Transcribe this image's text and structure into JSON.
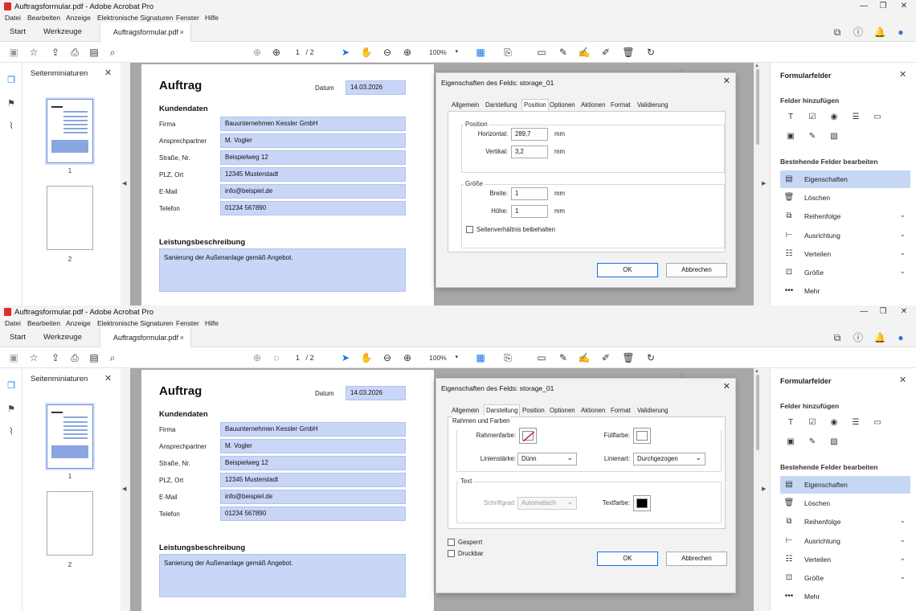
{
  "window": {
    "title": "Auftragsformular.pdf - Adobe Acrobat Pro",
    "controls": {
      "minimize": "—",
      "restore": "❐",
      "close": "✕"
    }
  },
  "menu": [
    "Datei",
    "Bearbeiten",
    "Anzeige",
    "Elektronische Signaturen",
    "Fenster",
    "Hilfe"
  ],
  "tabs": {
    "start": "Start",
    "tools": "Werkzeuge",
    "doc": "Auftragsformular.pdf",
    "close": "×"
  },
  "toolbar": {
    "page_current": "1",
    "page_sep": "/",
    "page_total": "2",
    "zoom": "100%"
  },
  "thumbnails": {
    "title": "Seitenminiaturen",
    "close": "✕",
    "pages": [
      {
        "label": "1"
      },
      {
        "label": "2"
      }
    ]
  },
  "document": {
    "title": "Auftrag",
    "date_label": "Datum",
    "date_value": "14.03.2026",
    "section_customer": "Kundendaten",
    "fields": [
      {
        "label": "Firma",
        "value": "Bauunternehmen Kessler GmbH"
      },
      {
        "label": "Ansprechpartner",
        "value": "M. Vogler"
      },
      {
        "label": "Straße, Nr.",
        "value": "Beispielweg 12"
      },
      {
        "label": "PLZ, Ort",
        "value": "12345 Musterstadt"
      },
      {
        "label": "E-Mail",
        "value": "info@beispiel.de"
      },
      {
        "label": "Telefon",
        "value": "01234 567890"
      }
    ],
    "section_service": "Leistungsbeschreibung",
    "service_text": "Sanierung der Außenanlage gemäß Angebot."
  },
  "dialog": {
    "title": "Eigenschaften des Felds: storage_01",
    "close": "✕",
    "tabs": [
      "Allgemein",
      "Darstellung",
      "Position",
      "Optionen",
      "Aktionen",
      "Format",
      "Validierung"
    ],
    "position_tab": {
      "group_position": "Position",
      "horizontal_label": "Horizontal:",
      "horizontal_value": "289,7",
      "vertical_label": "Vertikal:",
      "vertical_value": "3,2",
      "group_size": "Größe",
      "width_label": "Breite:",
      "width_value": "1",
      "height_label": "Höhe:",
      "height_value": "1",
      "unit": "mm",
      "aspect_label": "Seitenverhältnis beibehalten"
    },
    "appearance_tab": {
      "group_border": "Rahmen und Farben",
      "border_color_label": "Rahmenfarbe:",
      "fill_color_label": "Füllfarbe:",
      "line_width_label": "Linienstärke:",
      "line_width_value": "Dünn",
      "line_style_label": "Linienart:",
      "line_style_value": "Durchgezogen",
      "group_text": "Text",
      "font_size_label": "Schriftgrad:",
      "font_size_value": "Automatisch",
      "text_color_label": "Textfarbe:",
      "text_color": "#000000",
      "locked_label": "Gesperrt",
      "printable_label": "Druckbar"
    },
    "ok": "OK",
    "cancel": "Abbrechen"
  },
  "right_panel": {
    "title": "Formularfelder",
    "close": "✕",
    "add_fields": "Felder hinzufügen",
    "edit_fields": "Bestehende Felder bearbeiten",
    "items": [
      {
        "label": "Eigenschaften",
        "icon": "properties-icon",
        "chevron": false
      },
      {
        "label": "Löschen",
        "icon": "trash-icon",
        "chevron": false
      },
      {
        "label": "Reihenfolge",
        "icon": "order-icon",
        "chevron": true
      },
      {
        "label": "Ausrichtung",
        "icon": "align-icon",
        "chevron": true
      },
      {
        "label": "Verteilen",
        "icon": "distribute-icon",
        "chevron": true
      },
      {
        "label": "Größe",
        "icon": "size-icon",
        "chevron": true
      },
      {
        "label": "Mehr",
        "icon": "more-icon",
        "chevron": false
      }
    ]
  },
  "colors": {
    "accent": "#1473e6",
    "field_fill": "#c9d6f7",
    "selected_row": "#c5d7f5"
  }
}
